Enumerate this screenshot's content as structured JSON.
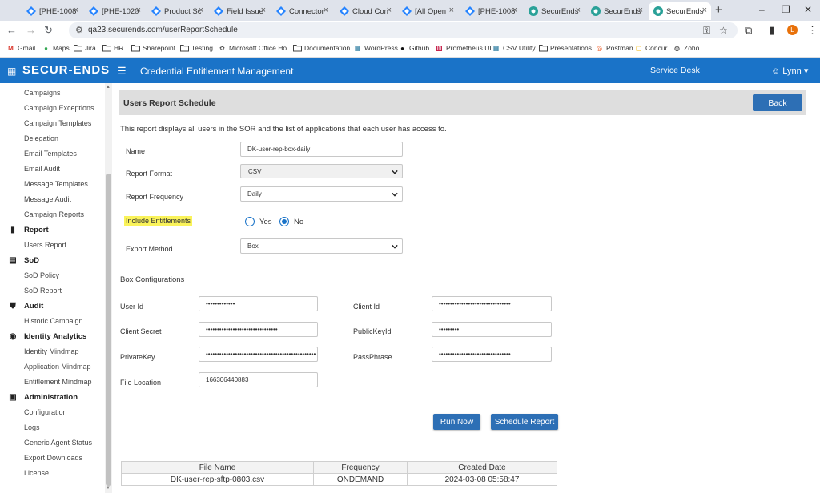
{
  "browser": {
    "tabs": [
      {
        "title": "[PHE-1008",
        "icon": "jira-icon",
        "color": "#2684ff"
      },
      {
        "title": "[PHE-1020",
        "icon": "jira-icon",
        "color": "#2684ff"
      },
      {
        "title": "Product Sc",
        "icon": "jira-icon",
        "color": "#2684ff"
      },
      {
        "title": "Field Issue",
        "icon": "jira-icon",
        "color": "#2684ff"
      },
      {
        "title": "Connector",
        "icon": "jira-icon",
        "color": "#2684ff"
      },
      {
        "title": "Cloud Con",
        "icon": "jira-icon",
        "color": "#2684ff"
      },
      {
        "title": "[All Open",
        "icon": "jira-icon",
        "color": "#2684ff"
      },
      {
        "title": "[PHE-1008",
        "icon": "jira-icon",
        "color": "#2684ff"
      },
      {
        "title": "SecurEnds",
        "icon": "securends-icon",
        "color": "#2aa198"
      },
      {
        "title": "SecurEnds",
        "icon": "securends-icon",
        "color": "#2aa198"
      },
      {
        "title": "SecurEnds",
        "icon": "securends-icon",
        "color": "#2aa198",
        "active": true
      }
    ],
    "url": "qa23.securends.com/userReportSchedule",
    "avatar_letter": "L",
    "bookmarks": [
      {
        "label": "Gmail",
        "icon": "gmail-icon"
      },
      {
        "label": "Maps",
        "icon": "maps-icon"
      },
      {
        "label": "Jira",
        "icon": "folder-icon"
      },
      {
        "label": "HR",
        "icon": "folder-icon"
      },
      {
        "label": "Sharepoint",
        "icon": "folder-icon"
      },
      {
        "label": "Testing",
        "icon": "folder-icon"
      },
      {
        "label": "Microsoft Office Ho...",
        "icon": "office-icon"
      },
      {
        "label": "Documentation",
        "icon": "folder-icon"
      },
      {
        "label": "WordPress",
        "icon": "wordpress-icon"
      },
      {
        "label": "Github",
        "icon": "github-icon"
      },
      {
        "label": "Prometheus UI",
        "icon": "prometheus-icon"
      },
      {
        "label": "CSV Utility",
        "icon": "csv-icon"
      },
      {
        "label": "Presentations",
        "icon": "folder-icon"
      },
      {
        "label": "Postman",
        "icon": "postman-icon"
      },
      {
        "label": "Concur",
        "icon": "concur-icon"
      },
      {
        "label": "Zoho",
        "icon": "zoho-icon"
      }
    ]
  },
  "app": {
    "logo": "SECUR-ENDS",
    "title": "Credential Entitlement Management",
    "service_desk": "Service Desk",
    "user": "Lynn",
    "brand_color": "#1a73c8"
  },
  "sidebar": {
    "items": [
      {
        "label": "Campaigns",
        "type": "item"
      },
      {
        "label": "Campaign Exceptions",
        "type": "item"
      },
      {
        "label": "Campaign Templates",
        "type": "item"
      },
      {
        "label": "Delegation",
        "type": "item"
      },
      {
        "label": "Email Templates",
        "type": "item"
      },
      {
        "label": "Email Audit",
        "type": "item"
      },
      {
        "label": "Message Templates",
        "type": "item"
      },
      {
        "label": "Message Audit",
        "type": "item"
      },
      {
        "label": "Campaign Reports",
        "type": "item"
      },
      {
        "label": "Report",
        "type": "head",
        "icon": "report-icon"
      },
      {
        "label": "Users Report",
        "type": "item"
      },
      {
        "label": "SoD",
        "type": "head",
        "icon": "sod-icon"
      },
      {
        "label": "SoD Policy",
        "type": "item"
      },
      {
        "label": "SoD Report",
        "type": "item"
      },
      {
        "label": "Audit",
        "type": "head",
        "icon": "shield-icon"
      },
      {
        "label": "Historic Campaign",
        "type": "item"
      },
      {
        "label": "Identity Analytics",
        "type": "head",
        "icon": "analytics-icon"
      },
      {
        "label": "Identity Mindmap",
        "type": "item"
      },
      {
        "label": "Application Mindmap",
        "type": "item"
      },
      {
        "label": "Entitlement Mindmap",
        "type": "item"
      },
      {
        "label": "Administration",
        "type": "head",
        "icon": "admin-icon"
      },
      {
        "label": "Configuration",
        "type": "item"
      },
      {
        "label": "Logs",
        "type": "item"
      },
      {
        "label": "Generic Agent Status",
        "type": "item"
      },
      {
        "label": "Export Downloads",
        "type": "item"
      },
      {
        "label": "License",
        "type": "item"
      }
    ]
  },
  "page": {
    "title": "Users Report Schedule",
    "back": "Back",
    "description": "This report displays all users in the SOR and the list of applications that each user has access to."
  },
  "form": {
    "name_label": "Name",
    "name_value": "DK-user-rep-box-daily",
    "format_label": "Report Format",
    "format_value": "CSV",
    "frequency_label": "Report Frequency",
    "frequency_value": "Daily",
    "entitlements_label": "Include Entitlements",
    "yes": "Yes",
    "no": "No",
    "entitlements_selected": "No",
    "export_label": "Export Method",
    "export_value": "Box",
    "highlight_color": "#faf35a"
  },
  "box": {
    "section_title": "Box Configurations",
    "user_id_label": "User Id",
    "user_id_value": "•••••••••••••",
    "client_id_label": "Client Id",
    "client_id_value": "••••••••••••••••••••••••••••••••",
    "client_secret_label": "Client Secret",
    "client_secret_value": "••••••••••••••••••••••••••••••••",
    "public_key_label": "PublicKeyId",
    "public_key_value": "•••••••••",
    "private_key_label": "PrivateKey",
    "private_key_value": "•••••••••••••••••••••••••••••••••••••••••••••••••",
    "passphrase_label": "PassPhrase",
    "passphrase_value": "••••••••••••••••••••••••••••••••",
    "file_location_label": "File Location",
    "file_location_value": "166306440883"
  },
  "actions": {
    "run_now": "Run Now",
    "schedule": "Schedule Report"
  },
  "table": {
    "headers": [
      "File Name",
      "Frequency",
      "Created Date"
    ],
    "rows": [
      [
        "DK-user-rep-sftp-0803.csv",
        "ONDEMAND",
        "2024-03-08 05:58:47"
      ]
    ]
  }
}
